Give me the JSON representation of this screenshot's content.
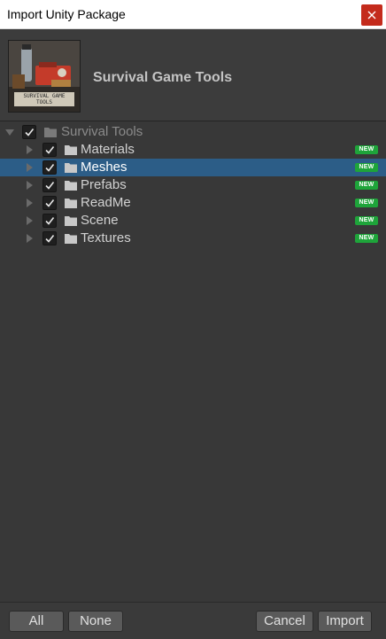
{
  "window": {
    "title": "Import Unity Package"
  },
  "header": {
    "package_name": "Survival Game Tools",
    "thumbnail_caption": "SURVIVAL GAME TOOLS"
  },
  "tree": {
    "root": {
      "label": "Survival Tools",
      "expanded": true,
      "checked": true
    },
    "items": [
      {
        "label": "Materials",
        "checked": true,
        "badge": "NEW",
        "selected": false
      },
      {
        "label": "Meshes",
        "checked": true,
        "badge": "NEW",
        "selected": true
      },
      {
        "label": "Prefabs",
        "checked": true,
        "badge": "NEW",
        "selected": false
      },
      {
        "label": "ReadMe",
        "checked": true,
        "badge": "NEW",
        "selected": false
      },
      {
        "label": "Scene",
        "checked": true,
        "badge": "NEW",
        "selected": false
      },
      {
        "label": "Textures",
        "checked": true,
        "badge": "NEW",
        "selected": false
      }
    ]
  },
  "footer": {
    "all_label": "All",
    "none_label": "None",
    "cancel_label": "Cancel",
    "import_label": "Import"
  },
  "colors": {
    "selection": "#2c5d87",
    "new_badge": "#1ea43a",
    "close_button": "#c42b1c"
  }
}
